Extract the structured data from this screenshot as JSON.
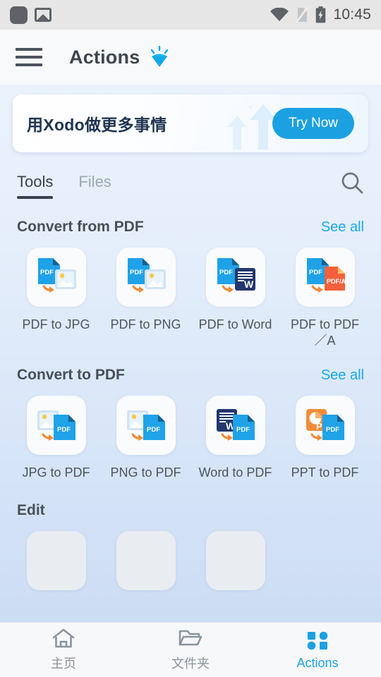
{
  "statusbar": {
    "time": "10:45",
    "icons": [
      "rounded-square-icon",
      "image-icon",
      "wifi-icon",
      "no-sim-icon",
      "battery-charging-icon"
    ]
  },
  "appbar": {
    "menu_icon": "hamburger-menu-icon",
    "title": "Actions",
    "badge_icon": "gem-icon"
  },
  "banner": {
    "text": "用Xodo做更多事情",
    "cta_label": "Try Now",
    "art": "upward-arrows-sparkles",
    "cta_color": "#1ba1e2"
  },
  "tabs": [
    {
      "label": "Tools",
      "active": true
    },
    {
      "label": "Files",
      "active": false
    }
  ],
  "search": {
    "icon": "search-icon"
  },
  "sections": [
    {
      "title": "Convert from PDF",
      "see_all": "See all",
      "items": [
        {
          "label": "PDF to JPG",
          "icon": "pdf-to-image-icon"
        },
        {
          "label": "PDF to PNG",
          "icon": "pdf-to-image-icon"
        },
        {
          "label": "PDF to Word",
          "icon": "pdf-to-word-icon"
        },
        {
          "label": "PDF to PDF／A",
          "icon": "pdf-to-pdfa-icon"
        }
      ]
    },
    {
      "title": "Convert to PDF",
      "see_all": "See all",
      "items": [
        {
          "label": "JPG to PDF",
          "icon": "image-to-pdf-icon"
        },
        {
          "label": "PNG to PDF",
          "icon": "image-to-pdf-icon"
        },
        {
          "label": "Word to PDF",
          "icon": "word-to-pdf-icon"
        },
        {
          "label": "PPT to PDF",
          "icon": "ppt-to-pdf-icon"
        }
      ]
    }
  ],
  "edit_section": {
    "title": "Edit"
  },
  "bottomnav": [
    {
      "label": "主页",
      "icon": "home-icon",
      "active": false
    },
    {
      "label": "文件夹",
      "icon": "folder-icon",
      "active": false
    },
    {
      "label": "Actions",
      "icon": "grid-apps-icon",
      "active": true
    }
  ],
  "colors": {
    "accent": "#1ba1e2",
    "link": "#17a9e8",
    "text_primary": "#3e464f",
    "text_muted": "#8b949d",
    "pdf_blue": "#1fa2e8",
    "word_navy": "#23376e",
    "pdfa_orange": "#f4613c",
    "ppt_orange": "#f28c3a",
    "arrow_orange": "#f7862f"
  }
}
